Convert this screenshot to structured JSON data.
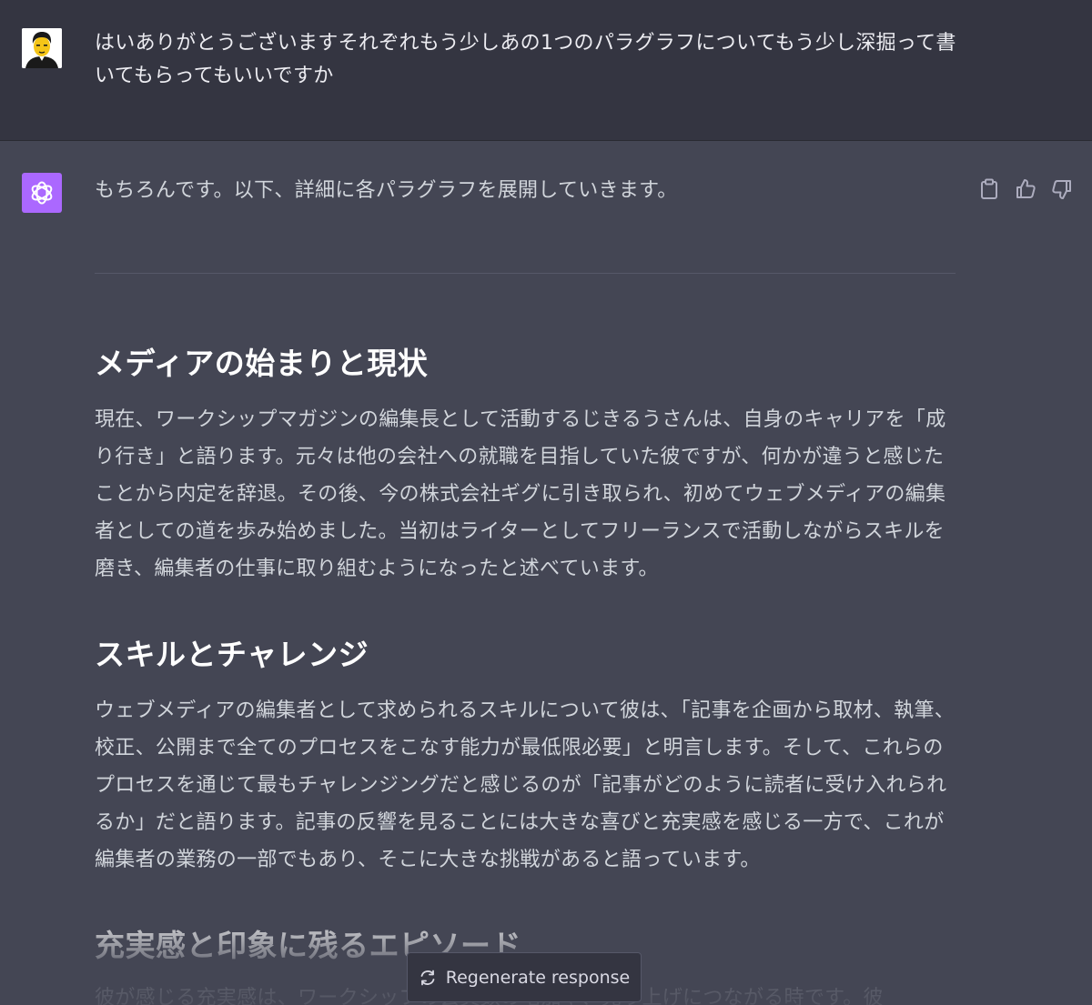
{
  "user_message": {
    "avatar": "user-avatar-cartoon",
    "text": "はいありがとうございますそれぞれもう少しあの1つのパラグラフについてもう少し深掘って書いてもらってもいいですか"
  },
  "assistant_message": {
    "avatar": "openai-logo-icon",
    "intro": "もちろんです。以下、詳細に各パラグラフを展開していきます。",
    "actions": {
      "copy": "clipboard-icon",
      "like": "thumbs-up-icon",
      "dislike": "thumbs-down-icon"
    },
    "sections": [
      {
        "title": "メディアの始まりと現状",
        "body": "現在、ワークシップマガジンの編集長として活動するじきるうさんは、自身のキャリアを「成り行き」と語ります。元々は他の会社への就職を目指していた彼ですが、何かが違うと感じたことから内定を辞退。その後、今の株式会社ギグに引き取られ、初めてウェブメディアの編集者としての道を歩み始めました。当初はライターとしてフリーランスで活動しながらスキルを磨き、編集者の仕事に取り組むようになったと述べています。"
      },
      {
        "title": "スキルとチャレンジ",
        "body": "ウェブメディアの編集者として求められるスキルについて彼は、「記事を企画から取材、執筆、校正、公開まで全てのプロセスをこなす能力が最低限必要」と明言します。そして、これらのプロセスを通じて最もチャレンジングだと感じるのが「記事がどのように読者に受け入れられるか」だと語ります。記事の反響を見ることには大きな喜びと充実感を感じる一方で、これが編集者の業務の一部でもあり、そこに大きな挑戦があると語っています。"
      },
      {
        "title": "充実感と印象に残るエピソード",
        "body": "彼が感じる充実感は、ワークシップの会員数の増加や、売り上げにつながる時です。彼"
      }
    ]
  },
  "regenerate": {
    "icon": "refresh-icon",
    "label": "Regenerate response"
  },
  "colors": {
    "user_bg": "#343541",
    "assistant_bg": "#444654",
    "avatar_bot_bg": "#ab68ff",
    "text": "#d1d5db",
    "heading": "#ffffff"
  }
}
